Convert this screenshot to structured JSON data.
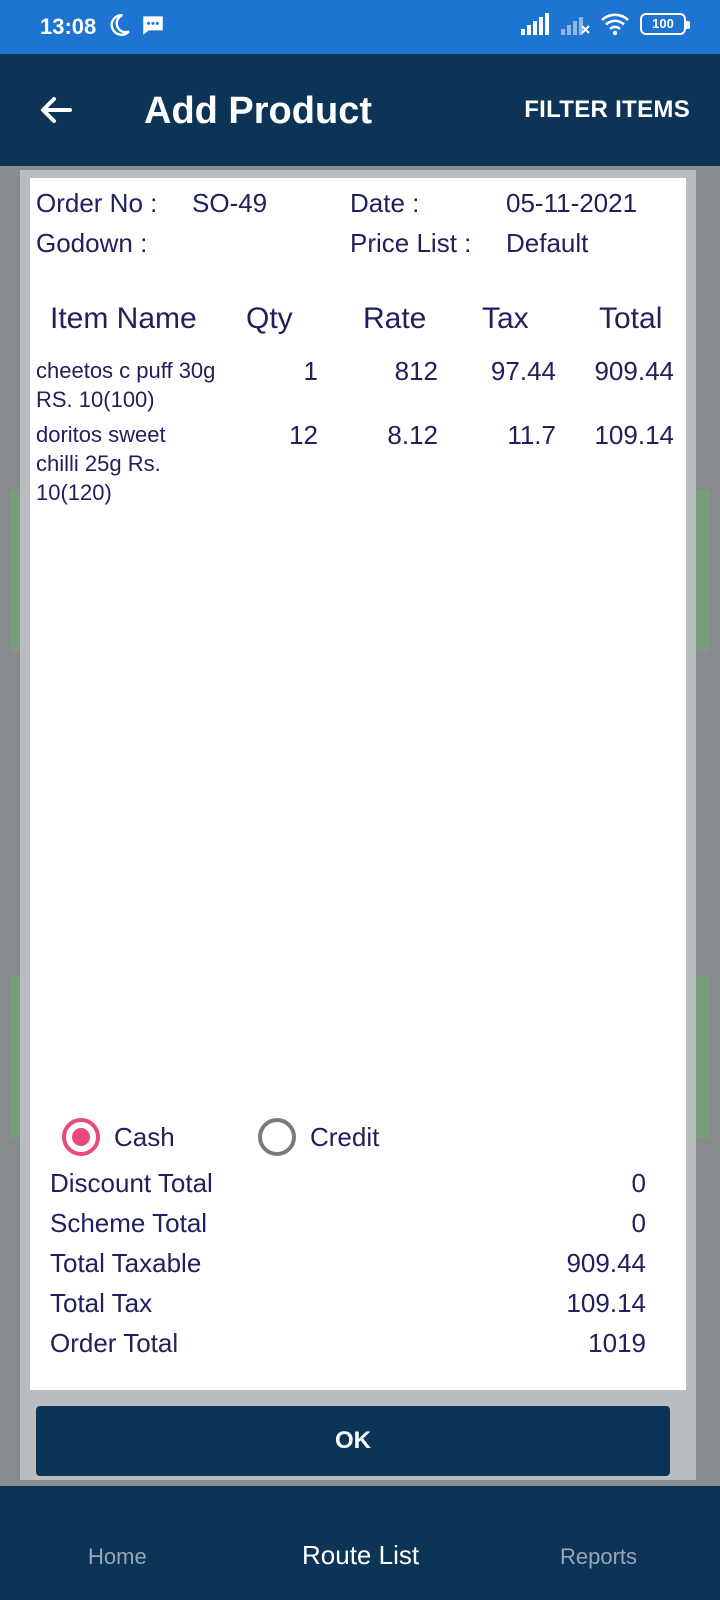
{
  "status_bar": {
    "time": "13:08",
    "battery": "100",
    "icons": [
      "moon-icon",
      "message-icon",
      "signal-icon",
      "signal-off-icon",
      "wifi-icon",
      "battery-icon"
    ]
  },
  "app_bar": {
    "title": "Add Product",
    "action": "FILTER ITEMS"
  },
  "order": {
    "order_no_label": "Order No :",
    "order_no": "SO-49",
    "date_label": "Date :",
    "date": "05-11-2021",
    "godown_label": "Godown :",
    "price_list_label": "Price List :",
    "price_list": "Default"
  },
  "table": {
    "headers": [
      "Item Name",
      "Qty",
      "Rate",
      "Tax",
      "Total"
    ],
    "rows": [
      {
        "name": "cheetos c puff 30g RS. 10(100)",
        "qty": "1",
        "rate": "812",
        "tax": "97.44",
        "total": "909.44"
      },
      {
        "name": "doritos sweet chilli 25g Rs. 10(120)",
        "qty": "12",
        "rate": "8.12",
        "tax": "11.7",
        "total": "109.14"
      }
    ]
  },
  "payment": {
    "options": [
      "Cash",
      "Credit"
    ],
    "selected": "Cash"
  },
  "summary": [
    {
      "label": "Discount Total",
      "value": "0"
    },
    {
      "label": "Scheme Total",
      "value": "0"
    },
    {
      "label": "Total Taxable",
      "value": "909.44"
    },
    {
      "label": "Total Tax",
      "value": "109.14"
    },
    {
      "label": "Order Total",
      "value": "1019"
    }
  ],
  "ok_label": "OK",
  "nav": {
    "items": [
      "Home",
      "Route List",
      "Reports"
    ],
    "active": "Route List"
  },
  "colors": {
    "primary": "#0b3456",
    "status_bar": "#1e74d1",
    "text": "#21205c",
    "radio_accent": "#e84a7e"
  }
}
